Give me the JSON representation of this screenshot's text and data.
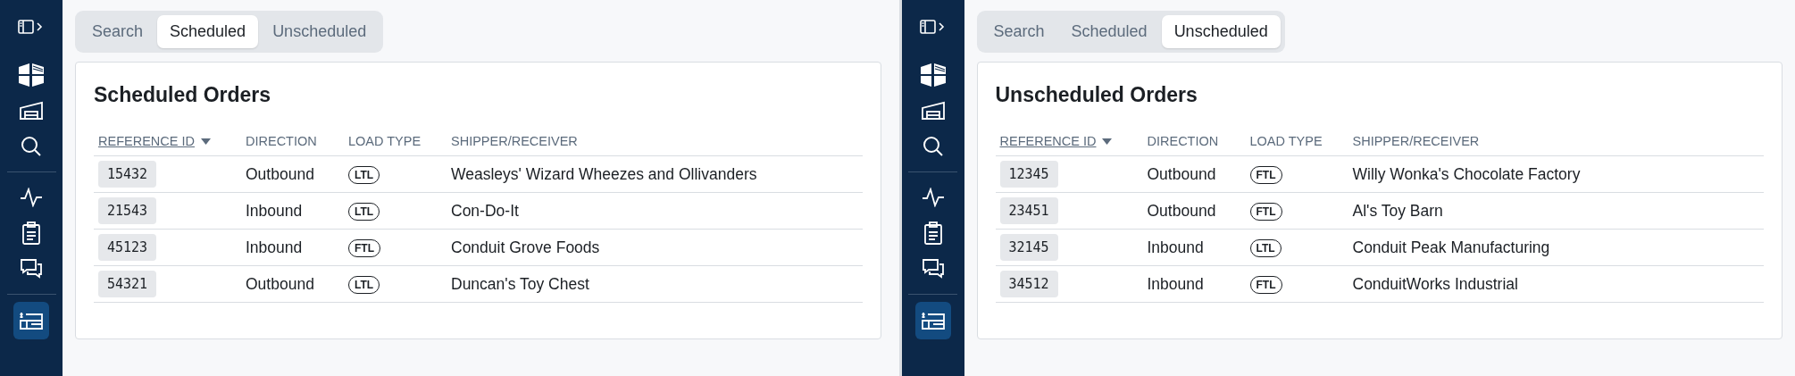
{
  "panes": [
    {
      "sidebar": {
        "groups": [
          [
            {
              "kind": "collapse",
              "selected": false
            }
          ],
          [
            {
              "kind": "logo",
              "selected": false
            },
            {
              "kind": "warehouse",
              "selected": false
            },
            {
              "kind": "search",
              "selected": false
            }
          ],
          [
            {
              "kind": "activity",
              "selected": false
            },
            {
              "kind": "clipboard",
              "selected": false
            },
            {
              "kind": "chat",
              "selected": false
            }
          ],
          [
            {
              "kind": "billing",
              "selected": true
            }
          ]
        ]
      },
      "tabs": [
        {
          "label": "Search",
          "selected": false
        },
        {
          "label": "Scheduled",
          "selected": true
        },
        {
          "label": "Unscheduled",
          "selected": false
        }
      ],
      "card": {
        "title": "Scheduled Orders",
        "columns": [
          {
            "label": "REFERENCE ID",
            "sorted": true
          },
          {
            "label": "DIRECTION",
            "sorted": false
          },
          {
            "label": "LOAD TYPE",
            "sorted": false
          },
          {
            "label": "SHIPPER/RECEIVER",
            "sorted": false
          }
        ],
        "rows": [
          {
            "reference_id": "15432",
            "direction": "Outbound",
            "load_type": "LTL",
            "shipper_receiver": "Weasleys' Wizard Wheezes and Ollivanders"
          },
          {
            "reference_id": "21543",
            "direction": "Inbound",
            "load_type": "LTL",
            "shipper_receiver": "Con-Do-It"
          },
          {
            "reference_id": "45123",
            "direction": "Inbound",
            "load_type": "FTL",
            "shipper_receiver": "Conduit Grove Foods"
          },
          {
            "reference_id": "54321",
            "direction": "Outbound",
            "load_type": "LTL",
            "shipper_receiver": "Duncan's Toy Chest"
          }
        ]
      }
    },
    {
      "sidebar": {
        "groups": [
          [
            {
              "kind": "collapse",
              "selected": false
            }
          ],
          [
            {
              "kind": "logo",
              "selected": false
            },
            {
              "kind": "warehouse",
              "selected": false
            },
            {
              "kind": "search",
              "selected": false
            }
          ],
          [
            {
              "kind": "activity",
              "selected": false
            },
            {
              "kind": "clipboard",
              "selected": false
            },
            {
              "kind": "chat",
              "selected": false
            }
          ],
          [
            {
              "kind": "billing",
              "selected": true
            }
          ]
        ]
      },
      "tabs": [
        {
          "label": "Search",
          "selected": false
        },
        {
          "label": "Scheduled",
          "selected": false
        },
        {
          "label": "Unscheduled",
          "selected": true
        }
      ],
      "card": {
        "title": "Unscheduled Orders",
        "columns": [
          {
            "label": "REFERENCE ID",
            "sorted": true
          },
          {
            "label": "DIRECTION",
            "sorted": false
          },
          {
            "label": "LOAD TYPE",
            "sorted": false
          },
          {
            "label": "SHIPPER/RECEIVER",
            "sorted": false
          }
        ],
        "rows": [
          {
            "reference_id": "12345",
            "direction": "Outbound",
            "load_type": "FTL",
            "shipper_receiver": "Willy Wonka's Chocolate Factory"
          },
          {
            "reference_id": "23451",
            "direction": "Outbound",
            "load_type": "FTL",
            "shipper_receiver": "Al's Toy Barn"
          },
          {
            "reference_id": "32145",
            "direction": "Inbound",
            "load_type": "LTL",
            "shipper_receiver": "Conduit Peak Manufacturing"
          },
          {
            "reference_id": "34512",
            "direction": "Inbound",
            "load_type": "FTL",
            "shipper_receiver": "ConduitWorks Industrial"
          }
        ]
      }
    }
  ]
}
